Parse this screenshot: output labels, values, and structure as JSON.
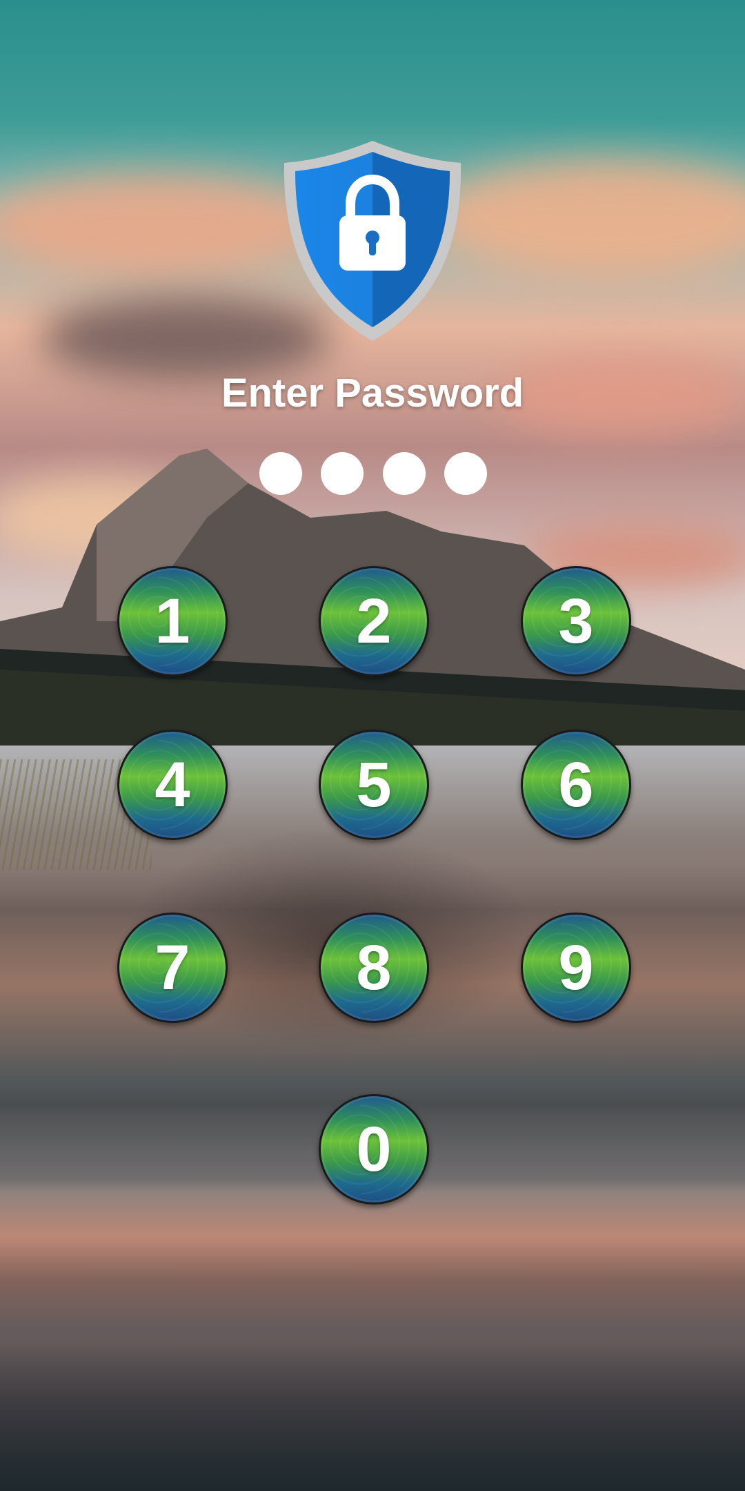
{
  "lock_screen": {
    "icon": "shield-lock-icon",
    "title": "Enter Password",
    "pin_length": 4,
    "pin_entered": 0
  },
  "keypad": {
    "keys": [
      "1",
      "2",
      "3",
      "4",
      "5",
      "6",
      "7",
      "8",
      "9",
      "0"
    ]
  },
  "colors": {
    "shield_blue": "#1f7ed6",
    "shield_border": "#c9c9c9",
    "key_green": "#6cc23a",
    "key_blue": "#1d4f86",
    "dot_color": "#ffffff"
  }
}
